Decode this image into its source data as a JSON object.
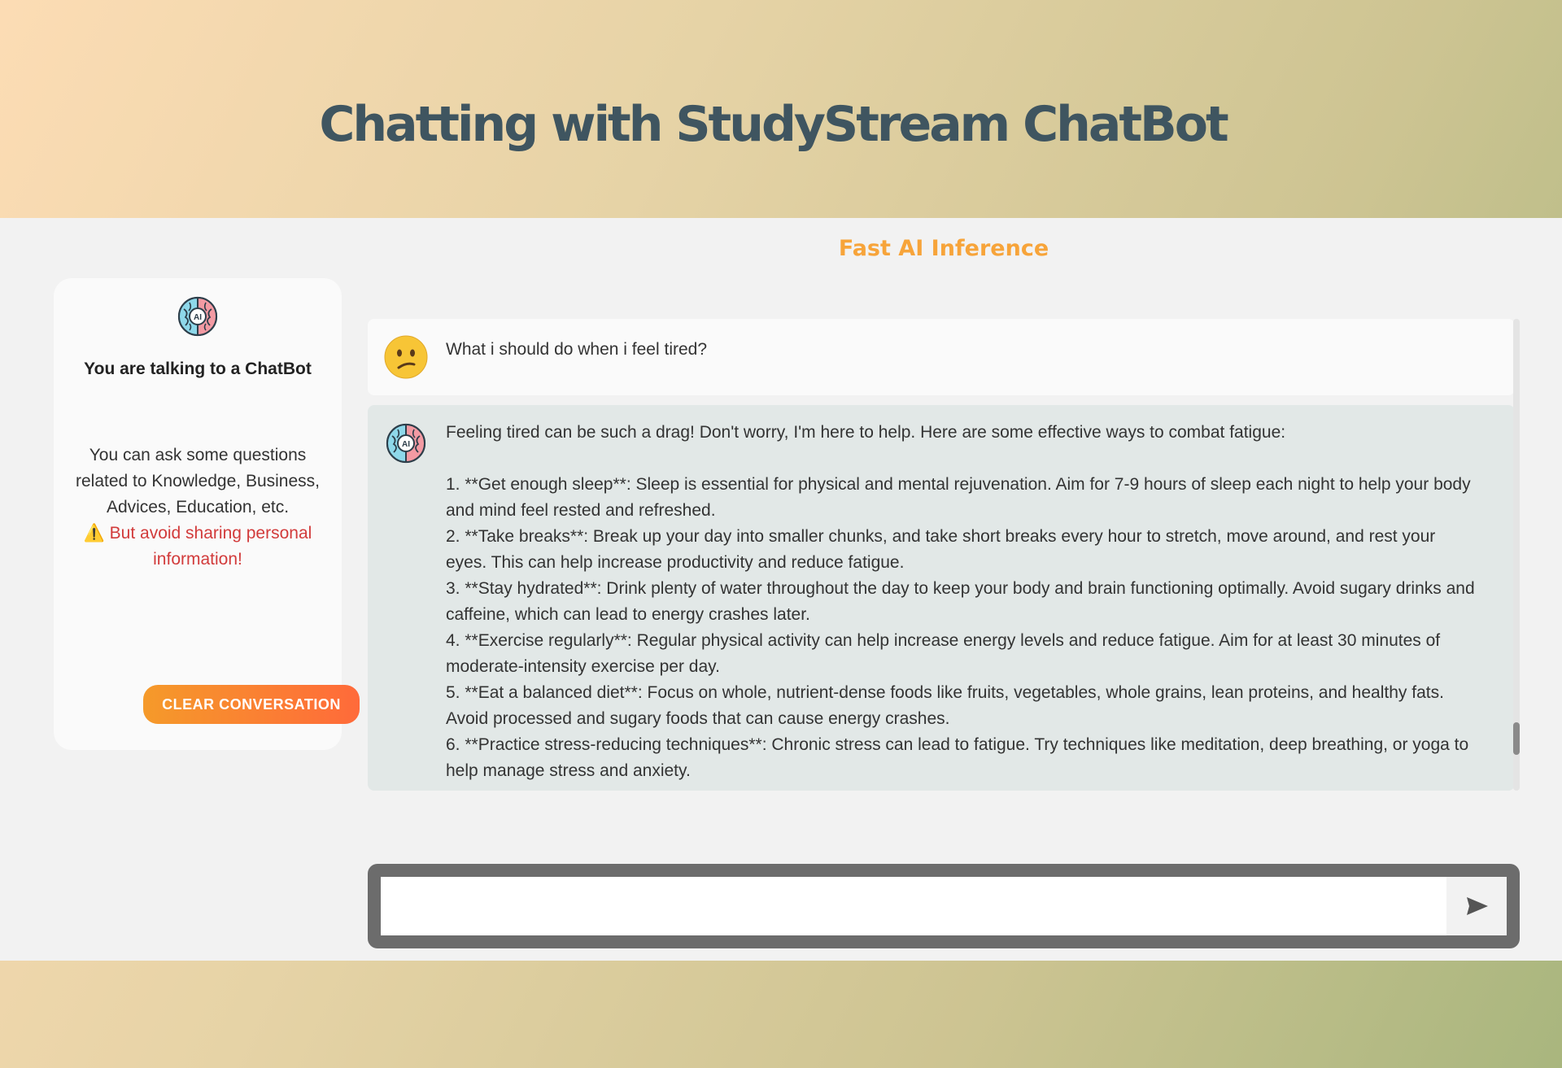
{
  "header": {
    "title": "Chatting with StudyStream ChatBot"
  },
  "subtitle": "Fast AI Inference",
  "sidebar": {
    "heading": "You are talking to a ChatBot",
    "info": "You can ask some questions related to Knowledge, Business, Advices, Education, etc.",
    "warning": "⚠️ But avoid sharing personal information!",
    "clear_button": "CLEAR CONVERSATION"
  },
  "messages": {
    "user": {
      "avatar_icon": "confused-face-icon",
      "text": "What i should do when i feel tired?"
    },
    "bot": {
      "avatar_icon": "ai-brain-icon",
      "intro": "Feeling tired can be such a drag! Don't worry, I'm here to help. Here are some effective ways to combat fatigue:",
      "items": [
        "1. **Get enough sleep**: Sleep is essential for physical and mental rejuvenation. Aim for 7-9 hours of sleep each night to help your body and mind feel rested and refreshed.",
        "2. **Take breaks**: Break up your day into smaller chunks, and take short breaks every hour to stretch, move around, and rest your eyes. This can help increase productivity and reduce fatigue.",
        "3. **Stay hydrated**: Drink plenty of water throughout the day to keep your body and brain functioning optimally. Avoid sugary drinks and caffeine, which can lead to energy crashes later.",
        "4. **Exercise regularly**: Regular physical activity can help increase energy levels and reduce fatigue. Aim for at least 30 minutes of moderate-intensity exercise per day.",
        "5. **Eat a balanced diet**: Focus on whole, nutrient-dense foods like fruits, vegetables, whole grains, lean proteins, and healthy fats. Avoid processed and sugary foods that can cause energy crashes.",
        "6. **Practice stress-reducing techniques**: Chronic stress can lead to fatigue. Try techniques like meditation, deep breathing, or yoga to help manage stress and anxiety."
      ]
    }
  },
  "input": {
    "value": "",
    "send_icon": "send-icon"
  },
  "colors": {
    "title": "#3f5560",
    "accent": "#f7a43a",
    "warning": "#d23b3b",
    "button_gradient_start": "#f59a2a",
    "button_gradient_end": "#ff6a3a"
  }
}
